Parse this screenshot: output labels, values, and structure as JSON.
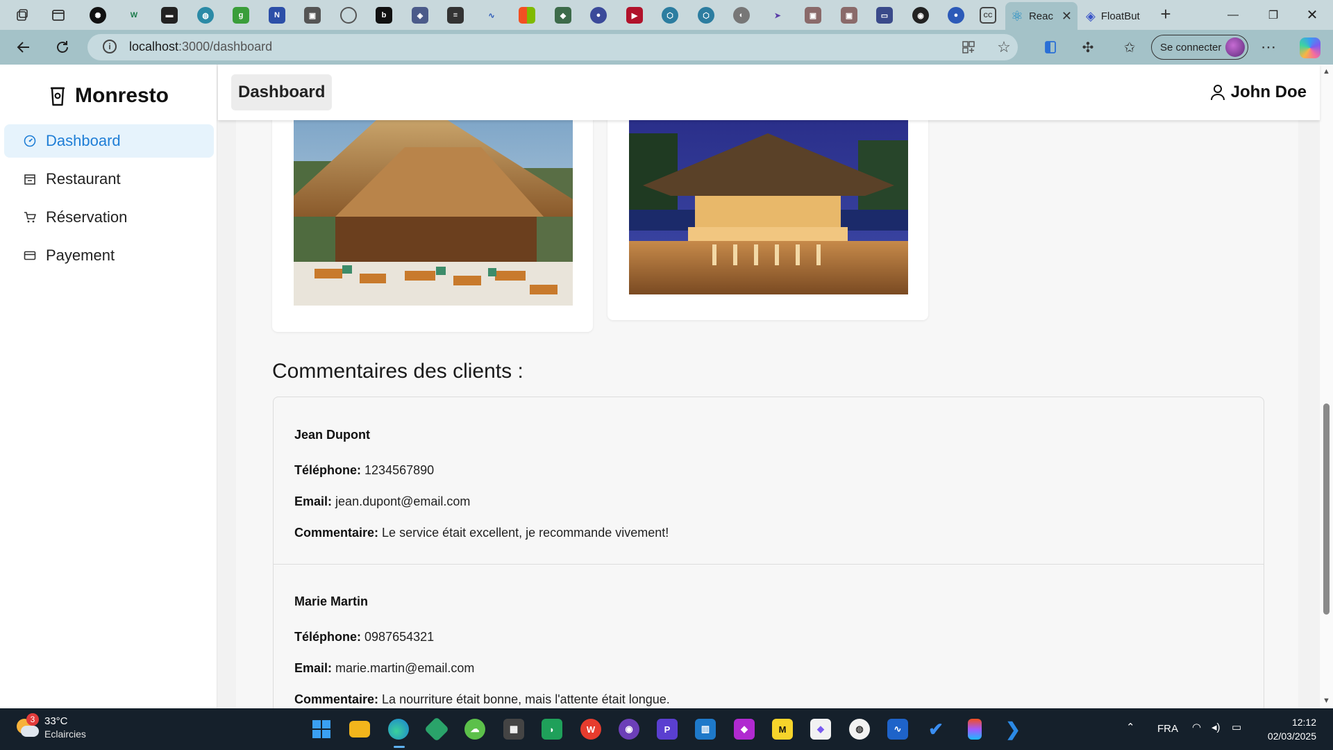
{
  "browser": {
    "active_tab_title": "Reac",
    "second_tab_title": "FloatBut",
    "url_host": "localhost",
    "url_path": ":3000/dashboard",
    "signin_label": "Se connecter"
  },
  "app": {
    "brand": "Monresto",
    "page_title": "Dashboard",
    "user_name": "John Doe",
    "menu": [
      {
        "label": "Dashboard",
        "icon": "dashboard-icon",
        "active": true
      },
      {
        "label": "Restaurant",
        "icon": "restaurant-icon",
        "active": false
      },
      {
        "label": "Réservation",
        "icon": "cart-icon",
        "active": false
      },
      {
        "label": "Payement",
        "icon": "card-icon",
        "active": false
      }
    ],
    "accent_color": "#1f7ed6"
  },
  "comments": {
    "title": "Commentaires des clients :",
    "phone_label": "Téléphone:",
    "email_label": "Email:",
    "comment_label": "Commentaire:",
    "items": [
      {
        "name": "Jean Dupont",
        "phone": "1234567890",
        "email": "jean.dupont@email.com",
        "comment": "Le service était excellent, je recommande vivement!"
      },
      {
        "name": "Marie Martin",
        "phone": "0987654321",
        "email": "marie.martin@email.com",
        "comment": "La nourriture était bonne, mais l'attente était longue."
      }
    ]
  },
  "taskbar": {
    "weather_temp": "33°C",
    "weather_desc": "Eclaircies",
    "weather_badge": "3",
    "language": "FRA",
    "time": "12:12",
    "date": "02/03/2025"
  }
}
